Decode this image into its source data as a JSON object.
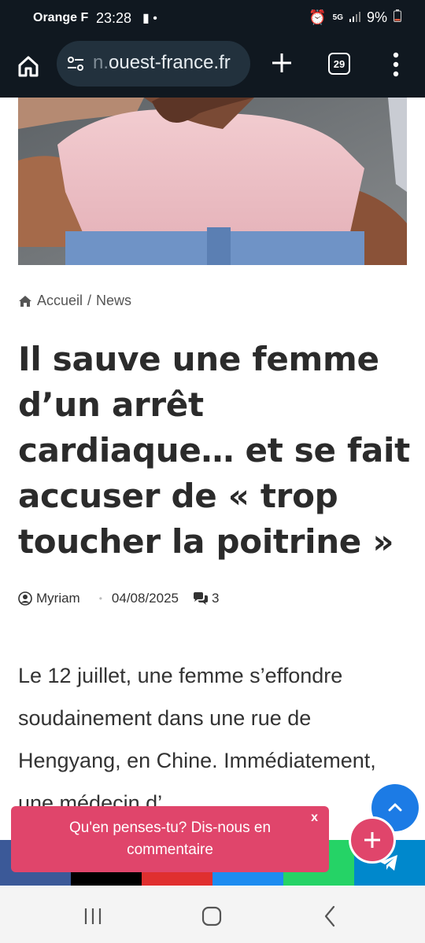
{
  "status_bar": {
    "carrier": "Orange F",
    "time": "23:28",
    "battery": "9%",
    "network": "5G"
  },
  "browser": {
    "url_prefix": "n.",
    "url_main": "ouest-france.fr",
    "tab_count": "29"
  },
  "breadcrumb": {
    "home": "Accueil",
    "separator": "/",
    "section": "News"
  },
  "article": {
    "title": "Il sauve une femme d’un arrêt cardiaque… et se fait accuser de « trop toucher la poitrine »",
    "author": "Myriam",
    "date": "04/08/2025",
    "comments": "3",
    "body": "Le 12 juillet, une femme s’effondre soudainement dans une rue de Hengyang, en Chine. Immédiatement, une médecin d’"
  },
  "toast": {
    "message": "Qu'en penses-tu? Dis-nous en commentaire",
    "close": "x"
  },
  "colors": {
    "accent": "#e0456b",
    "fab_blue": "#1c7be5",
    "share": [
      "#3b5998",
      "#000000",
      "#e02f2f",
      "#1d8cf0",
      "#25d366",
      "#0088cc"
    ]
  }
}
